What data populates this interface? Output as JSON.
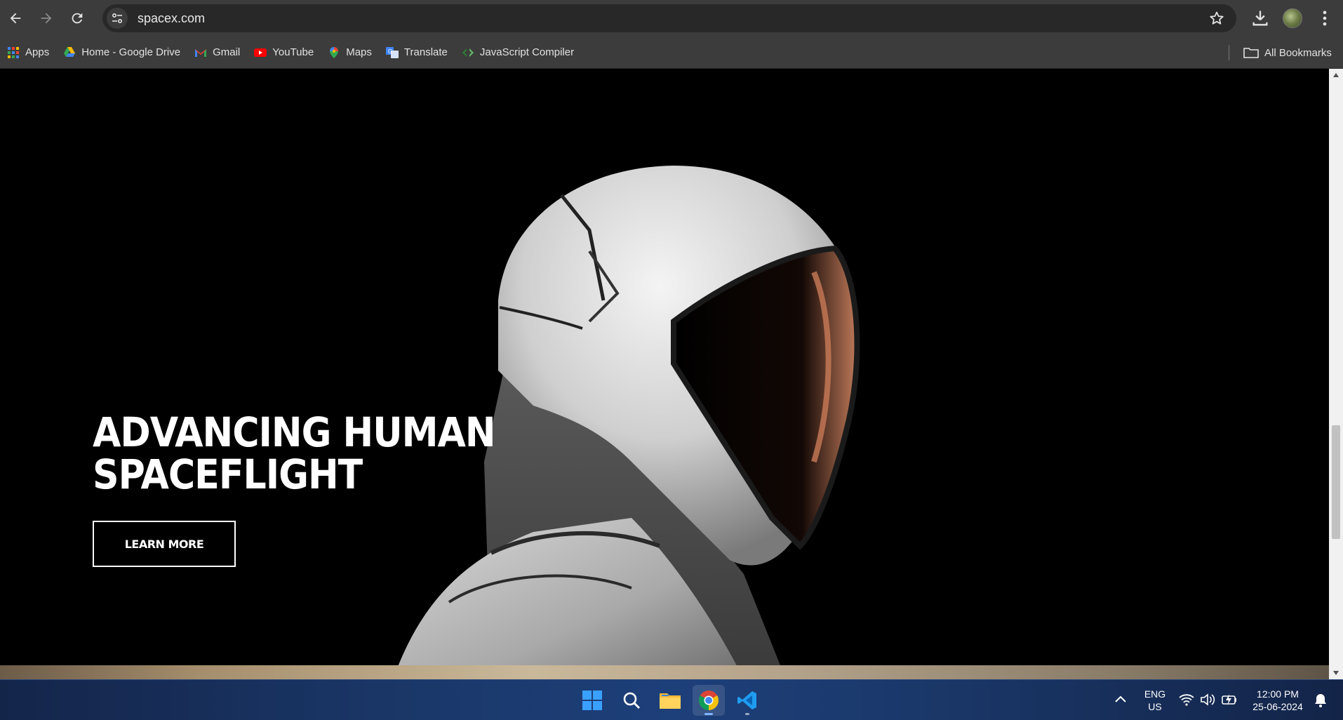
{
  "browser": {
    "url": "spacex.com",
    "bookmarks": [
      {
        "label": "Apps",
        "icon": "apps-grid-icon"
      },
      {
        "label": "Home - Google Drive",
        "icon": "google-drive-icon"
      },
      {
        "label": "Gmail",
        "icon": "gmail-icon"
      },
      {
        "label": "YouTube",
        "icon": "youtube-icon"
      },
      {
        "label": "Maps",
        "icon": "maps-pin-icon"
      },
      {
        "label": "Translate",
        "icon": "translate-icon"
      },
      {
        "label": "JavaScript Compiler",
        "icon": "code-icon"
      }
    ],
    "all_bookmarks_label": "All Bookmarks"
  },
  "hero": {
    "headline_line1": "ADVANCING HUMAN",
    "headline_line2": "SPACEFLIGHT",
    "cta_label": "LEARN MORE"
  },
  "taskbar": {
    "apps": [
      "windows-start-icon",
      "search-icon",
      "file-explorer-icon",
      "chrome-icon",
      "vscode-icon"
    ],
    "language_line1": "ENG",
    "language_line2": "US",
    "time": "12:00 PM",
    "date": "25-06-2024"
  },
  "colors": {
    "chrome_bg": "#3c3c3c",
    "omnibox_bg": "#282828",
    "page_bg": "#000000",
    "taskbar_bg": "#1a3768"
  }
}
